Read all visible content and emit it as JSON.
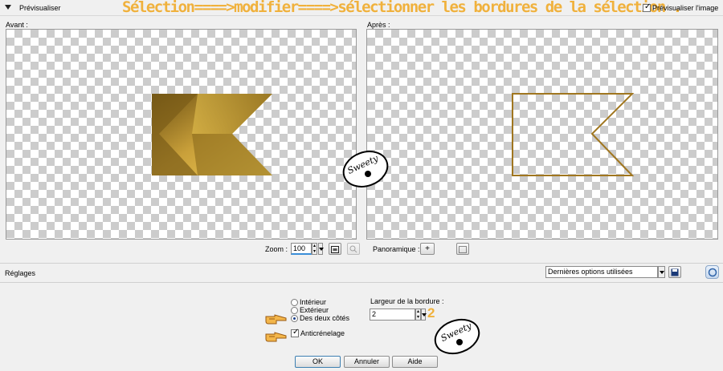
{
  "header": {
    "preview_title": "Prévisualiser",
    "instruction": "Sélection====>modifier====>sélectionner les bordures de la sélection .",
    "preview_image_label": "Prévisualiser l'image",
    "preview_image_checked": true
  },
  "panes": {
    "before_label": "Avant :",
    "after_label": "Après :"
  },
  "zoom": {
    "label": "Zoom :",
    "value": "100",
    "pan_label": "Panoramique :"
  },
  "settings": {
    "label": "Réglages",
    "preset_value": "Dernières options utilisées"
  },
  "options": {
    "radio_inside": "Intérieur",
    "radio_outside": "Extérieur",
    "radio_both": "Des deux côtés",
    "selected": "Des deux côtés",
    "antialias_label": "Anticrénelage",
    "antialias_checked": true,
    "border_width_label": "Largeur de la bordure :",
    "border_width_value": "2",
    "annotation_number": "2"
  },
  "watermark": {
    "text": "Sweety"
  },
  "buttons": {
    "ok": "OK",
    "cancel": "Annuler",
    "help": "Aide"
  },
  "colors": {
    "banner": "#f0b13c",
    "gold_dark": "#6b4f12",
    "gold_light": "#f0cc57",
    "ok_border": "#3c7fb1"
  }
}
